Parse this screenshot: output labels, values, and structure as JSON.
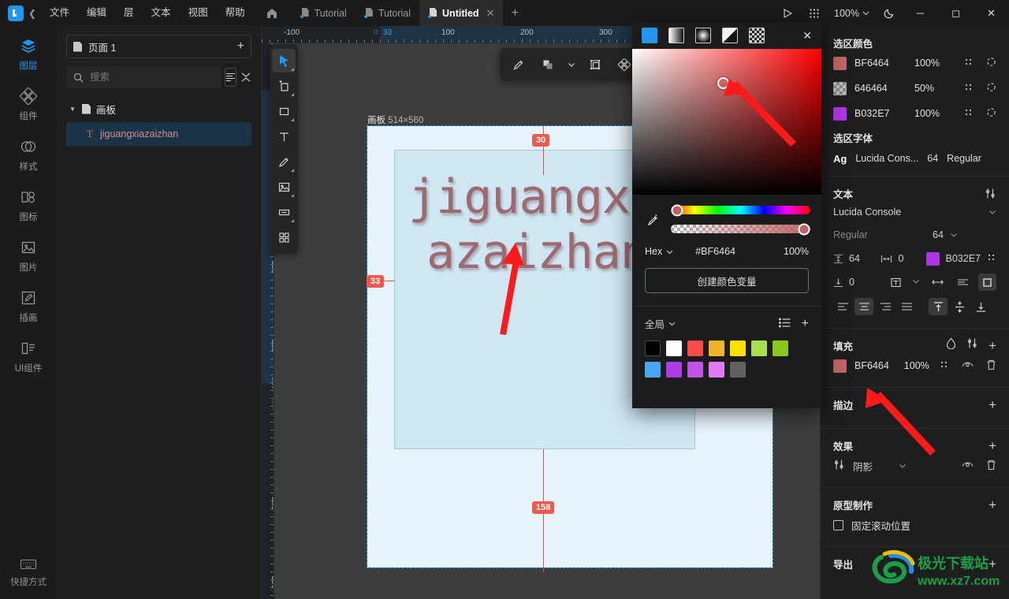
{
  "menu": {
    "items": [
      "文件",
      "编辑",
      "层",
      "文本",
      "视图",
      "帮助"
    ]
  },
  "tabs": [
    {
      "label": "Tutorial",
      "active": false
    },
    {
      "label": "Tutorial",
      "active": false
    },
    {
      "label": "Untitled",
      "active": true
    }
  ],
  "topright": {
    "zoom": "100%"
  },
  "rail": {
    "items": [
      {
        "label": "图层",
        "icon": "layers-icon",
        "active": true
      },
      {
        "label": "组件",
        "icon": "components-icon",
        "active": false
      },
      {
        "label": "样式",
        "icon": "styles-icon",
        "active": false
      },
      {
        "label": "图标",
        "icon": "icons-icon",
        "active": false
      },
      {
        "label": "图片",
        "icon": "image-icon",
        "active": false
      },
      {
        "label": "插画",
        "icon": "illustration-icon",
        "active": false
      },
      {
        "label": "UI组件",
        "icon": "ui-kit-icon",
        "active": false
      }
    ],
    "bottom": {
      "label": "快捷方式",
      "icon": "keyboard-icon"
    }
  },
  "layers": {
    "page_name": "页面 1",
    "search_placeholder": "搜索",
    "tree": {
      "root": "画板",
      "child": "jiguangxiazaizhan"
    }
  },
  "canvas": {
    "artboard_label": "画板",
    "artboard_size": "514×560",
    "text_line1": "jiguangx",
    "text_line2": "azaizhan",
    "badges": [
      "30",
      "33",
      "158"
    ]
  },
  "ruler": {
    "h_labels": [
      "-100",
      "0",
      "100",
      "200",
      "300"
    ],
    "h_highlight": "33",
    "v_labels": [
      "0",
      "100",
      "200",
      "300",
      "400",
      "500",
      "600"
    ],
    "v_highlight_top": "30",
    "v_highlight_bottom": "402"
  },
  "picker": {
    "modes": [
      "solid-fill",
      "linear-gradient",
      "radial-gradient",
      "angular-gradient",
      "image-fill"
    ],
    "hex_label": "Hex",
    "hex_value": "#BF6464",
    "opacity": "100%",
    "create_variable": "创建颜色变量",
    "swatch_scope": "全局",
    "swatches": [
      "#000000",
      "#FFFFFF",
      "#FF4A4A",
      "#F0B429",
      "#FAE100",
      "#A6E14B",
      "#8CC51B",
      "#49A7F5",
      "#B03CE7",
      "#C352E8",
      "#E07BF5",
      "#606060"
    ]
  },
  "right": {
    "selection_color_title": "选区颜色",
    "selection_colors": [
      {
        "hex": "BF6464",
        "opacity": "100%",
        "swatch": "#BF6464",
        "checker": false
      },
      {
        "hex": "646464",
        "opacity": "50%",
        "swatch": "#646464",
        "checker": true
      },
      {
        "hex": "B032E7",
        "opacity": "100%",
        "swatch": "#B032E7",
        "checker": false
      }
    ],
    "selection_font_title": "选区字体",
    "selection_font": {
      "ag": "Ag",
      "family": "Lucida Cons...",
      "size": "64",
      "weight": "Regular"
    },
    "text_title": "文本",
    "text": {
      "family": "Lucida Console",
      "weight": "Regular",
      "size": "64",
      "line_height": "64",
      "letter_spacing": "0",
      "color_hex": "B032E7",
      "color_swatch": "#B032E7",
      "paragraph_spacing": "0"
    },
    "fill_title": "填充",
    "fill": {
      "hex": "BF6464",
      "opacity": "100%",
      "swatch": "#BF6464"
    },
    "stroke_title": "描边",
    "effects_title": "效果",
    "effect": {
      "name": "阴影"
    },
    "prototype_title": "原型制作",
    "prototype_option": "固定滚动位置",
    "export_title": "导出"
  },
  "watermark": {
    "title": "极光下载站",
    "url": "www.xz7.com"
  },
  "colors": {
    "accent": "#2196f3",
    "fill_red": "#BF6464",
    "purple": "#B032E7",
    "measure_red": "#F0584E"
  }
}
